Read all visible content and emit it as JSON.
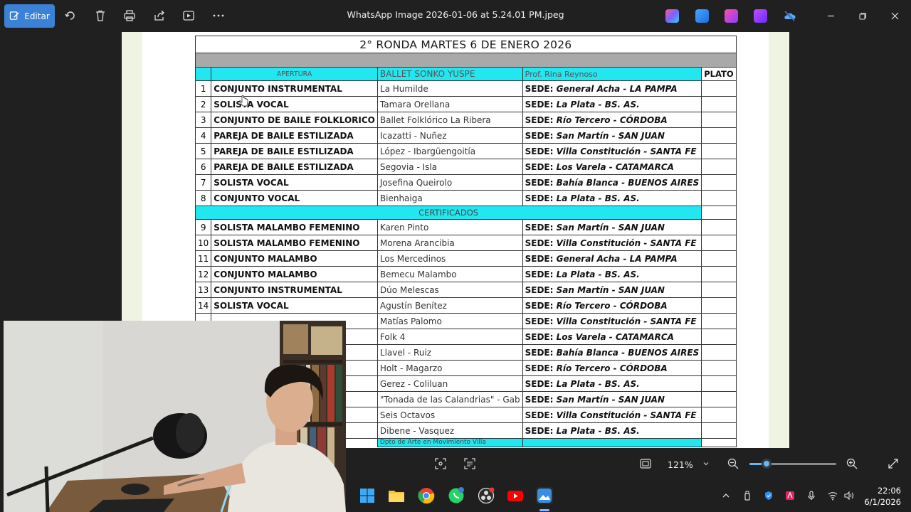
{
  "toolbar": {
    "edit_label": "Editar",
    "window_title": "WhatsApp Image 2026-01-06 at 5.24.01 PM.jpeg"
  },
  "sheet": {
    "title": "2° RONDA MARTES 6 DE ENERO 2026",
    "headers": {
      "apertura": "APERTURA",
      "ballet": "BALLET SONKO YUSPE",
      "prof": "Prof. Rina Reynoso",
      "plato": "PLATO"
    },
    "rows_group1": [
      {
        "num": "1",
        "category": "CONJUNTO INSTRUMENTAL",
        "name": "La Humilde",
        "sede_prefix": "SEDE:",
        "sede": "General Acha - LA PAMPA"
      },
      {
        "num": "2",
        "category": "SOLISTA VOCAL",
        "name": "Tamara Orellana",
        "sede_prefix": "SEDE:",
        "sede": "La Plata - BS. AS."
      },
      {
        "num": "3",
        "category": "CONJUNTO DE BAILE FOLKLORICO",
        "name": "Ballet Folklórico La Ribera",
        "sede_prefix": "SEDE:",
        "sede": "Río Tercero - CÓRDOBA"
      },
      {
        "num": "4",
        "category": "PAREJA DE BAILE ESTILIZADA",
        "name": "Icazatti - Nuñez",
        "sede_prefix": "SEDE:",
        "sede": "San Martín - SAN JUAN"
      },
      {
        "num": "5",
        "category": "PAREJA DE BAILE ESTILIZADA",
        "name": "López - Ibargüengoitía",
        "sede_prefix": "SEDE:",
        "sede": "Villa Constitución - SANTA FE"
      },
      {
        "num": "6",
        "category": "PAREJA DE BAILE ESTILIZADA",
        "name": "Segovia - Isla",
        "sede_prefix": "SEDE:",
        "sede": "Los Varela - CATAMARCA"
      },
      {
        "num": "7",
        "category": "SOLISTA VOCAL",
        "name": "Josefina Queirolo",
        "sede_prefix": "SEDE:",
        "sede": "Bahía Blanca - BUENOS AIRES"
      },
      {
        "num": "8",
        "category": "CONJUNTO VOCAL",
        "name": "Bienhaiga",
        "sede_prefix": "SEDE:",
        "sede": "La Plata - BS. AS."
      }
    ],
    "certificados_label": "CERTIFICADOS",
    "rows_group2": [
      {
        "num": "9",
        "category": "SOLISTA MALAMBO FEMENINO",
        "name": "Karen Pinto",
        "sede_prefix": "SEDE:",
        "sede": "San Martín - SAN JUAN"
      },
      {
        "num": "10",
        "category": "SOLISTA MALAMBO FEMENINO",
        "name": "Morena Arancibia",
        "sede_prefix": "SEDE:",
        "sede": "Villa Constitución - SANTA FE"
      },
      {
        "num": "11",
        "category": "CONJUNTO MALAMBO",
        "name": "Los Mercedinos",
        "sede_prefix": "SEDE:",
        "sede": "General Acha - LA PAMPA"
      },
      {
        "num": "12",
        "category": "CONJUNTO MALAMBO",
        "name": "Bemecu Malambo",
        "sede_prefix": "SEDE:",
        "sede": "La Plata - BS. AS."
      },
      {
        "num": "13",
        "category": "CONJUNTO INSTRUMENTAL",
        "name": "Dúo Melescas",
        "sede_prefix": "SEDE:",
        "sede": "San Martín - SAN JUAN"
      },
      {
        "num": "14",
        "category": "SOLISTA VOCAL",
        "name": "Agustín Benítez",
        "sede_prefix": "SEDE:",
        "sede": "Río Tercero - CÓRDOBA"
      },
      {
        "num": "",
        "category": "",
        "name": "Matías Palomo",
        "sede_prefix": "SEDE:",
        "sede": "Villa Constitución - SANTA FE"
      },
      {
        "num": "",
        "category": "",
        "name": "Folk 4",
        "sede_prefix": "SEDE:",
        "sede": "Los Varela - CATAMARCA"
      },
      {
        "num": "",
        "category": "",
        "name": "Llavel - Ruiz",
        "sede_prefix": "SEDE:",
        "sede": "Bahía Blanca - BUENOS AIRES"
      },
      {
        "num": "",
        "category": "",
        "name": "Holt - Magarzo",
        "sede_prefix": "SEDE:",
        "sede": "Río Tercero - CÓRDOBA"
      },
      {
        "num": "",
        "category": "",
        "name": "Gerez - Coliluan",
        "sede_prefix": "SEDE:",
        "sede": "La Plata - BS. AS."
      },
      {
        "num": "",
        "category": "",
        "name": "\"Tonada de las Calandrias\" - Gab",
        "sede_prefix": "SEDE:",
        "sede": "San Martín - SAN JUAN"
      },
      {
        "num": "",
        "category": "",
        "name": "Seis Octavos",
        "sede_prefix": "SEDE:",
        "sede": "Villa Constitución - SANTA FE"
      },
      {
        "num": "",
        "category": "",
        "name": "Dibene - Vasquez",
        "sede_prefix": "SEDE:",
        "sede": "La Plata - BS. AS."
      }
    ],
    "partial_row_label": "Dpto de Arte en Movimiento  Villa"
  },
  "viewer": {
    "zoom_label": "121%",
    "zoom_fraction": 0.2
  },
  "taskbar": {
    "time": "22:06",
    "date": "6/1/2026"
  },
  "colors": {
    "accent": "#3b82d6",
    "sheet_cyan": "#22e6f0",
    "sheet_grey": "#a9a9a9",
    "slider": "#60b8ff"
  }
}
